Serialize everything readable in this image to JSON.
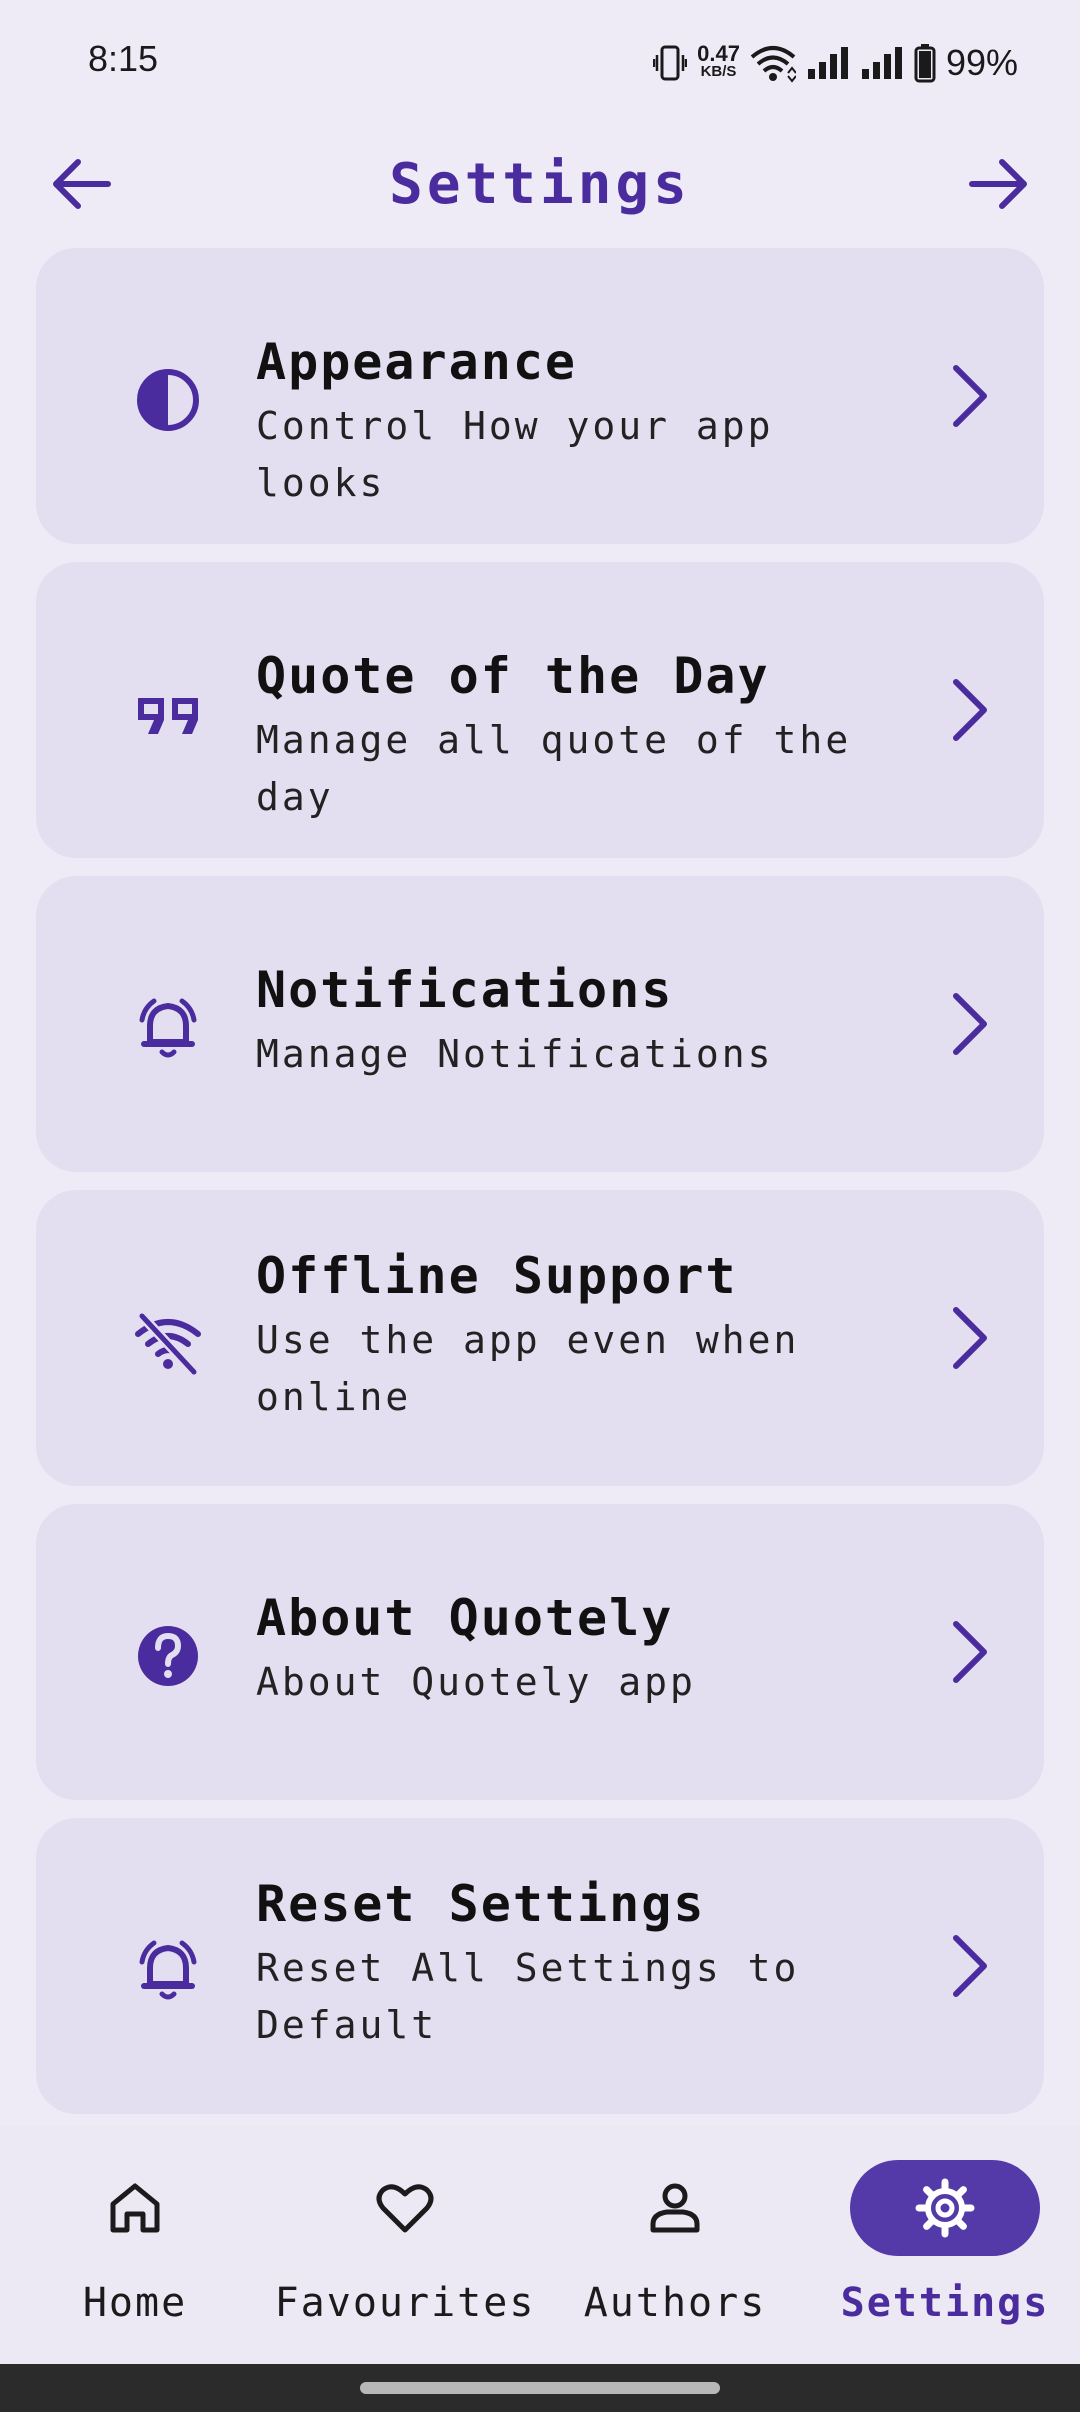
{
  "status": {
    "time": "8:15",
    "net_speed_value": "0.47",
    "net_speed_unit": "KB/S",
    "battery": "99%",
    "icons": [
      "vibrate-icon",
      "wifi-icon",
      "signal-icon",
      "signal-icon",
      "battery-icon"
    ]
  },
  "header": {
    "title": "Settings",
    "back_icon": "arrow-left-icon",
    "forward_icon": "arrow-right-icon"
  },
  "accent_color": "#4A2C9E",
  "settings": [
    {
      "title": "Appearance",
      "subtitle": "Control How your app looks",
      "icon": "contrast-icon"
    },
    {
      "title": "Quote of the Day",
      "subtitle": "Manage all quote of the day",
      "icon": "quote-icon"
    },
    {
      "title": "Notifications",
      "subtitle": "Manage Notifications",
      "icon": "bell-ring-icon"
    },
    {
      "title": "Offline Support",
      "subtitle": "Use the app even when online",
      "icon": "wifi-off-icon"
    },
    {
      "title": "About Quotely",
      "subtitle": "About Quotely app",
      "icon": "help-circle-icon"
    },
    {
      "title": "Reset Settings",
      "subtitle": "Reset All Settings to Default",
      "icon": "bell-ring-icon"
    }
  ],
  "bottom_nav": [
    {
      "label": "Home",
      "icon": "home-icon",
      "active": false
    },
    {
      "label": "Favourites",
      "icon": "heart-icon",
      "active": false
    },
    {
      "label": "Authors",
      "icon": "person-icon",
      "active": false
    },
    {
      "label": "Settings",
      "icon": "gear-icon",
      "active": true
    }
  ]
}
